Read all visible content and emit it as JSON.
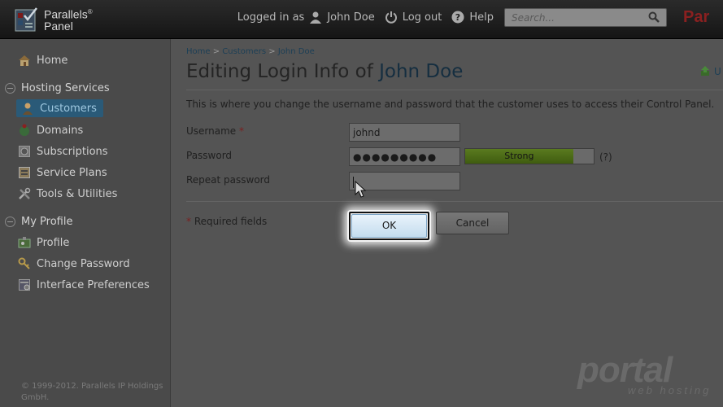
{
  "header": {
    "logo_line1": "Parallels",
    "logo_reg": "®",
    "logo_line2": "Panel",
    "logged_in_prefix": "Logged in as",
    "user_name": "John Doe",
    "logout_label": "Log out",
    "help_label": "Help",
    "search_placeholder": "Search...",
    "brand_right": "Par"
  },
  "sidebar": {
    "home": "Home",
    "hosting_services": "Hosting Services",
    "customers": "Customers",
    "domains": "Domains",
    "subscriptions": "Subscriptions",
    "service_plans": "Service Plans",
    "tools": "Tools & Utilities",
    "my_profile": "My Profile",
    "profile": "Profile",
    "change_password": "Change Password",
    "interface_prefs": "Interface Preferences",
    "footer_line1": "© 1999-2012. Parallels IP Holdings",
    "footer_line2": "GmbH."
  },
  "breadcrumb": {
    "home": "Home",
    "customers": "Customers",
    "john_doe": "John Doe",
    "sep": ">"
  },
  "page": {
    "title_prefix": "Editing Login Info of",
    "title_name": "John Doe",
    "corner_link": "U",
    "intro": "This is where you change the username and password that the customer uses to access their Control Panel."
  },
  "form": {
    "username_label": "Username",
    "required_mark": "*",
    "username_value": "johnd",
    "password_label": "Password",
    "password_value": "●●●●●●●●●",
    "strength_label": "Strong",
    "strength_fraction": 0.84,
    "help_mark": "(?)",
    "repeat_label": "Repeat password",
    "repeat_value": "",
    "required_note": "Required fields",
    "ok_label": "OK",
    "cancel_label": "Cancel"
  },
  "watermark": {
    "main": "portal",
    "sub": "web hosting"
  },
  "colors": {
    "accent": "#2a5a78",
    "strength": "#5a7a1f",
    "brand": "#8a2020"
  },
  "icons": [
    "home-icon",
    "user-icon",
    "logout-icon",
    "help-icon",
    "search-icon",
    "customers-icon",
    "domains-icon",
    "subscriptions-icon",
    "service-plans-icon",
    "tools-icon",
    "profile-icon",
    "key-icon",
    "preferences-icon",
    "upload-icon",
    "mouse-cursor-icon"
  ]
}
